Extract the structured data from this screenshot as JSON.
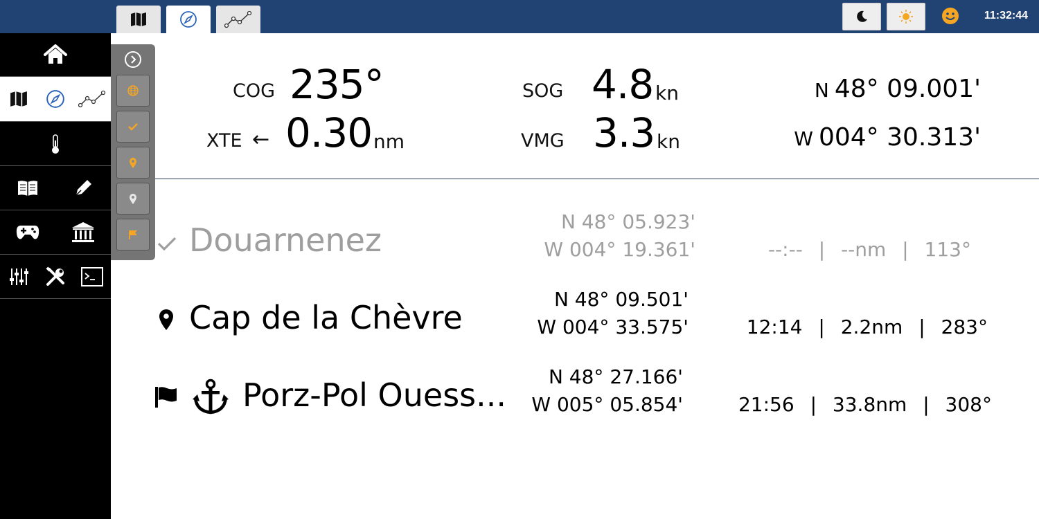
{
  "topbar": {
    "tabs": [
      {
        "name": "map-icon",
        "active": false
      },
      {
        "name": "compass-icon",
        "active": true
      },
      {
        "name": "route-graph-icon",
        "active": false
      }
    ],
    "night_mode_icon": "moon-icon",
    "day_mode_icon": "sun-icon",
    "status_icon": "smiley-icon",
    "clock": "11:32:44"
  },
  "sidebar": {
    "rows": [
      {
        "icons": [
          "home-icon"
        ]
      },
      {
        "icons": [
          "map-icon",
          "compass-icon",
          "route-graph-icon"
        ],
        "selected": true
      },
      {
        "icons": [
          "thermometer-icon"
        ]
      },
      {
        "icons": [
          "book-icon",
          "pen-icon"
        ]
      },
      {
        "icons": [
          "gamepad-icon",
          "museum-icon"
        ]
      },
      {
        "icons": [
          "mixer-icon",
          "tools-icon",
          "terminal-icon"
        ]
      }
    ]
  },
  "waypoint_toolbar": {
    "buttons": [
      "expand-icon",
      "globe-icon",
      "check-icon",
      "pin-orange-icon",
      "pin-grey-icon",
      "flag-icon"
    ]
  },
  "navigation": {
    "cog": {
      "label": "COG",
      "value": "235°"
    },
    "xte": {
      "label": "XTE",
      "arrow": "←",
      "value": "0.30",
      "unit": "nm"
    },
    "sog": {
      "label": "SOG",
      "value": "4.8",
      "unit": "kn"
    },
    "vmg": {
      "label": "VMG",
      "value": "3.3",
      "unit": "kn"
    },
    "position": {
      "lat_hemi": "N",
      "lat": "48° 09.001'",
      "lon_hemi": "W",
      "lon": "004° 30.313'"
    }
  },
  "colors": {
    "topbar": "#214373",
    "accent_orange": "#f5a623",
    "past_grey": "#9e9e9e"
  },
  "waypoints": [
    {
      "icon": "check-icon",
      "name": "Douarnenez",
      "lat": "N 48° 05.923'",
      "lon": "W 004° 19.361'",
      "eta": "--:--",
      "dist": "--nm",
      "bearing": "113°",
      "status": "passed"
    },
    {
      "icon": "pin-icon",
      "name": "Cap de la Chèvre",
      "lat": "N 48° 09.501'",
      "lon": "W 004° 33.575'",
      "eta": "12:14",
      "dist": "2.2nm",
      "bearing": "283°",
      "status": "next"
    },
    {
      "icon": "flag-icon",
      "icon2": "anchor-icon",
      "name": "Porz-Pol Ouess...",
      "lat": "N 48° 27.166'",
      "lon": "W 005° 05.854'",
      "eta": "21:56",
      "dist": "33.8nm",
      "bearing": "308°",
      "status": "destination"
    }
  ],
  "separator": "|"
}
